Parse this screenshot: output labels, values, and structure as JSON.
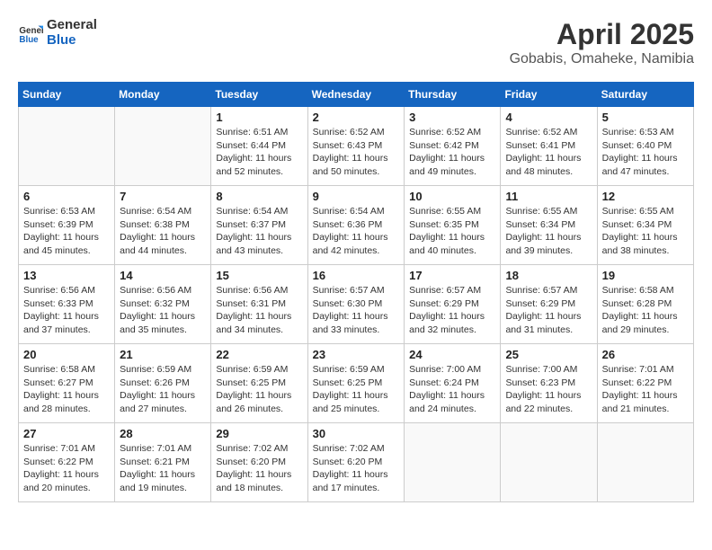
{
  "logo": {
    "line1": "General",
    "line2": "Blue"
  },
  "title": "April 2025",
  "subtitle": "Gobabis, Omaheke, Namibia",
  "days_of_week": [
    "Sunday",
    "Monday",
    "Tuesday",
    "Wednesday",
    "Thursday",
    "Friday",
    "Saturday"
  ],
  "weeks": [
    [
      {
        "day": "",
        "info": ""
      },
      {
        "day": "",
        "info": ""
      },
      {
        "day": "1",
        "info": "Sunrise: 6:51 AM\nSunset: 6:44 PM\nDaylight: 11 hours and 52 minutes."
      },
      {
        "day": "2",
        "info": "Sunrise: 6:52 AM\nSunset: 6:43 PM\nDaylight: 11 hours and 50 minutes."
      },
      {
        "day": "3",
        "info": "Sunrise: 6:52 AM\nSunset: 6:42 PM\nDaylight: 11 hours and 49 minutes."
      },
      {
        "day": "4",
        "info": "Sunrise: 6:52 AM\nSunset: 6:41 PM\nDaylight: 11 hours and 48 minutes."
      },
      {
        "day": "5",
        "info": "Sunrise: 6:53 AM\nSunset: 6:40 PM\nDaylight: 11 hours and 47 minutes."
      }
    ],
    [
      {
        "day": "6",
        "info": "Sunrise: 6:53 AM\nSunset: 6:39 PM\nDaylight: 11 hours and 45 minutes."
      },
      {
        "day": "7",
        "info": "Sunrise: 6:54 AM\nSunset: 6:38 PM\nDaylight: 11 hours and 44 minutes."
      },
      {
        "day": "8",
        "info": "Sunrise: 6:54 AM\nSunset: 6:37 PM\nDaylight: 11 hours and 43 minutes."
      },
      {
        "day": "9",
        "info": "Sunrise: 6:54 AM\nSunset: 6:36 PM\nDaylight: 11 hours and 42 minutes."
      },
      {
        "day": "10",
        "info": "Sunrise: 6:55 AM\nSunset: 6:35 PM\nDaylight: 11 hours and 40 minutes."
      },
      {
        "day": "11",
        "info": "Sunrise: 6:55 AM\nSunset: 6:34 PM\nDaylight: 11 hours and 39 minutes."
      },
      {
        "day": "12",
        "info": "Sunrise: 6:55 AM\nSunset: 6:34 PM\nDaylight: 11 hours and 38 minutes."
      }
    ],
    [
      {
        "day": "13",
        "info": "Sunrise: 6:56 AM\nSunset: 6:33 PM\nDaylight: 11 hours and 37 minutes."
      },
      {
        "day": "14",
        "info": "Sunrise: 6:56 AM\nSunset: 6:32 PM\nDaylight: 11 hours and 35 minutes."
      },
      {
        "day": "15",
        "info": "Sunrise: 6:56 AM\nSunset: 6:31 PM\nDaylight: 11 hours and 34 minutes."
      },
      {
        "day": "16",
        "info": "Sunrise: 6:57 AM\nSunset: 6:30 PM\nDaylight: 11 hours and 33 minutes."
      },
      {
        "day": "17",
        "info": "Sunrise: 6:57 AM\nSunset: 6:29 PM\nDaylight: 11 hours and 32 minutes."
      },
      {
        "day": "18",
        "info": "Sunrise: 6:57 AM\nSunset: 6:29 PM\nDaylight: 11 hours and 31 minutes."
      },
      {
        "day": "19",
        "info": "Sunrise: 6:58 AM\nSunset: 6:28 PM\nDaylight: 11 hours and 29 minutes."
      }
    ],
    [
      {
        "day": "20",
        "info": "Sunrise: 6:58 AM\nSunset: 6:27 PM\nDaylight: 11 hours and 28 minutes."
      },
      {
        "day": "21",
        "info": "Sunrise: 6:59 AM\nSunset: 6:26 PM\nDaylight: 11 hours and 27 minutes."
      },
      {
        "day": "22",
        "info": "Sunrise: 6:59 AM\nSunset: 6:25 PM\nDaylight: 11 hours and 26 minutes."
      },
      {
        "day": "23",
        "info": "Sunrise: 6:59 AM\nSunset: 6:25 PM\nDaylight: 11 hours and 25 minutes."
      },
      {
        "day": "24",
        "info": "Sunrise: 7:00 AM\nSunset: 6:24 PM\nDaylight: 11 hours and 24 minutes."
      },
      {
        "day": "25",
        "info": "Sunrise: 7:00 AM\nSunset: 6:23 PM\nDaylight: 11 hours and 22 minutes."
      },
      {
        "day": "26",
        "info": "Sunrise: 7:01 AM\nSunset: 6:22 PM\nDaylight: 11 hours and 21 minutes."
      }
    ],
    [
      {
        "day": "27",
        "info": "Sunrise: 7:01 AM\nSunset: 6:22 PM\nDaylight: 11 hours and 20 minutes."
      },
      {
        "day": "28",
        "info": "Sunrise: 7:01 AM\nSunset: 6:21 PM\nDaylight: 11 hours and 19 minutes."
      },
      {
        "day": "29",
        "info": "Sunrise: 7:02 AM\nSunset: 6:20 PM\nDaylight: 11 hours and 18 minutes."
      },
      {
        "day": "30",
        "info": "Sunrise: 7:02 AM\nSunset: 6:20 PM\nDaylight: 11 hours and 17 minutes."
      },
      {
        "day": "",
        "info": ""
      },
      {
        "day": "",
        "info": ""
      },
      {
        "day": "",
        "info": ""
      }
    ]
  ]
}
